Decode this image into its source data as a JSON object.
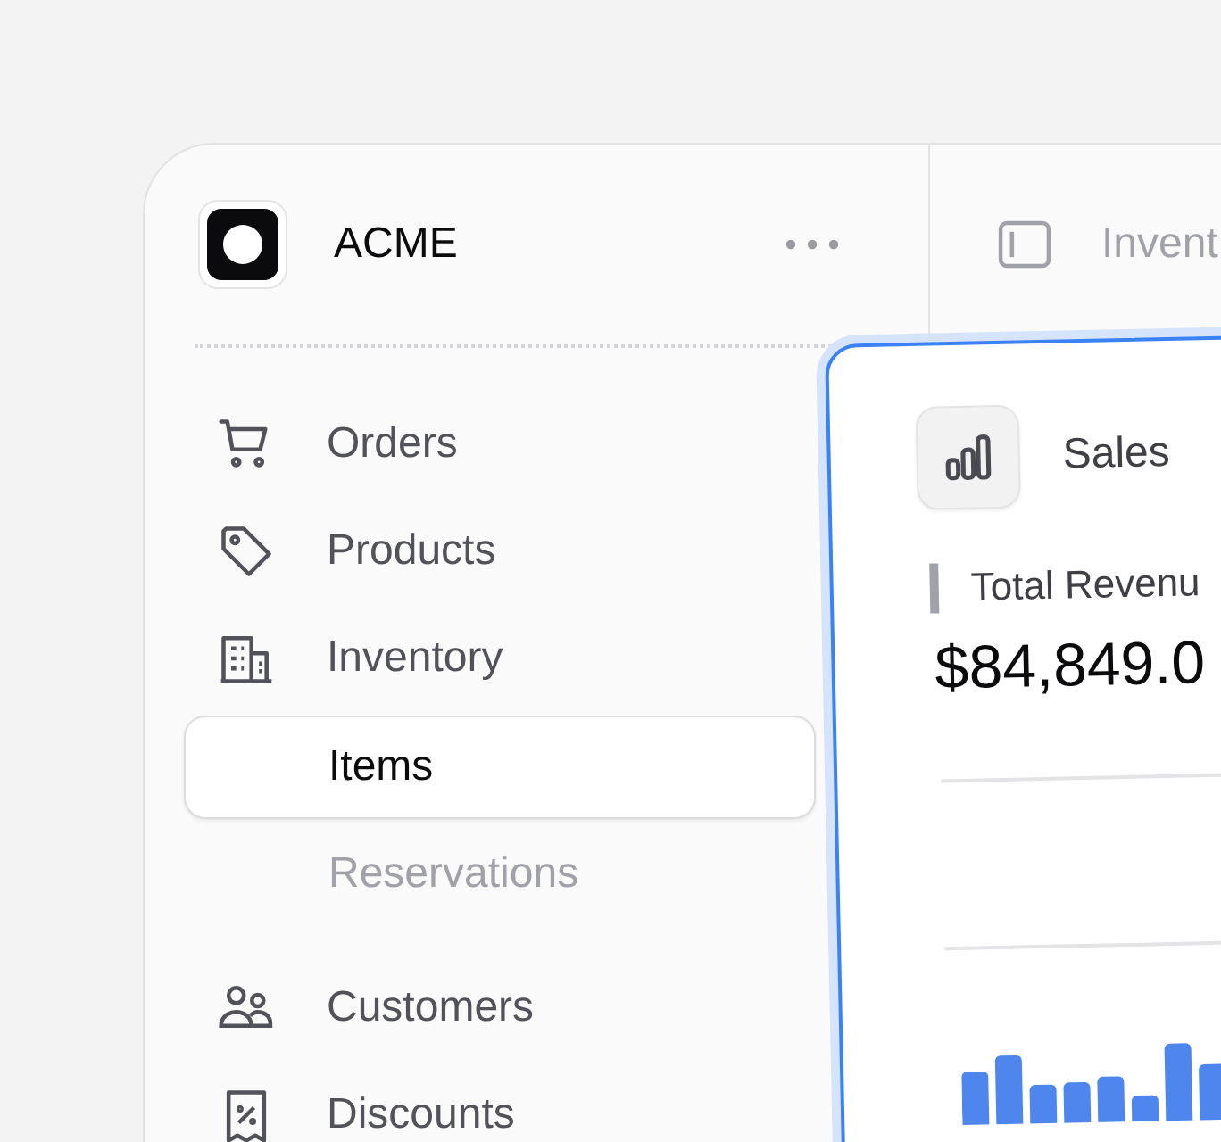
{
  "brand": {
    "name": "ACME"
  },
  "header": {
    "title": "Invent"
  },
  "nav": [
    {
      "label": "Orders",
      "selected": false
    },
    {
      "label": "Products",
      "selected": false
    },
    {
      "label": "Inventory",
      "selected": false,
      "children": [
        {
          "label": "Items",
          "selected": true
        },
        {
          "label": "Reservations",
          "selected": false
        }
      ]
    },
    {
      "label": "Customers",
      "selected": false
    },
    {
      "label": "Discounts",
      "selected": false
    }
  ],
  "card": {
    "title": "Sales",
    "metric_label": "Total Revenu",
    "metric_value": "$84,849.0"
  }
}
